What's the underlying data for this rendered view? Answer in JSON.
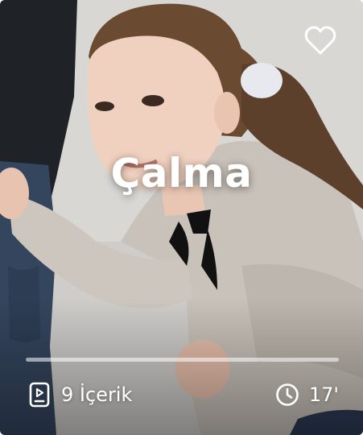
{
  "card": {
    "title": "Çalma",
    "content_count": "9 İçerik",
    "duration": "17'",
    "progress": 0
  },
  "icons": {
    "favorite": "heart-outline-icon",
    "content": "video-document-icon",
    "duration": "clock-icon"
  },
  "colors": {
    "text": "#ffffff",
    "progress_track": "rgba(255,255,255,0.55)"
  }
}
